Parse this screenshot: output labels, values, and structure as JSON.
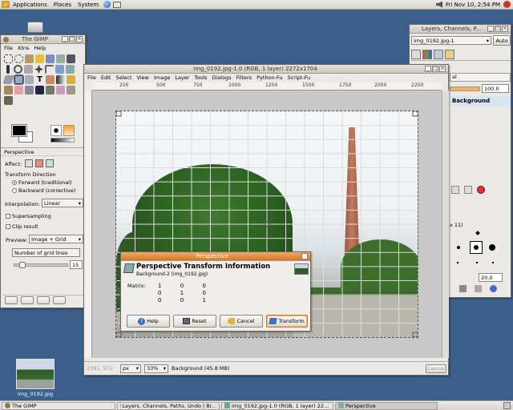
{
  "topbar": {
    "menus": [
      "Applications",
      "Places",
      "System"
    ],
    "datetime": "Fri Nov 10,  2:54 PM"
  },
  "desktop": {
    "file_label": "img_0192.jpg"
  },
  "toolbox": {
    "title": "The GIMP",
    "menus": [
      "File",
      "Xtns",
      "Help"
    ],
    "options_title": "Perspective",
    "affect_label": "Affect:",
    "direction_label": "Transform Direction",
    "forward_label": "Forward (traditional)",
    "backward_label": "Backward (corrective)",
    "interpolation_label": "Interpolation:",
    "interpolation_value": "Linear",
    "supersampling_label": "Supersampling",
    "clip_label": "Clip result",
    "preview_label": "Preview:",
    "preview_value": "Image + Grid",
    "grid_lines_label": "Number of grid lines",
    "grid_lines_value": "15"
  },
  "image_window": {
    "title": "img_0192.jpg-1.0 (RGB, 1 layer) 2272x1704",
    "menus": [
      "File",
      "Edit",
      "Select",
      "View",
      "Image",
      "Layer",
      "Tools",
      "Dialogs",
      "Filters",
      "Python-Fu",
      "Script-Fu"
    ],
    "ruler_ticks": [
      "250",
      "500",
      "750",
      "1000",
      "1250",
      "1500",
      "1750",
      "2000",
      "2250"
    ],
    "coords": "2391, 972",
    "unit": "px",
    "zoom": "33%",
    "status": "Background (45.8 MB)",
    "cancel_label": "Cancel"
  },
  "layers": {
    "title": "Layers, Channels, P...",
    "image_select": "img_0192.jpg-1",
    "auto_label": "Auto",
    "mode_value": "al",
    "opacity_value": "100.0",
    "layer_name": "Background",
    "brush_title": "x 11)",
    "spacing_value": "20.0"
  },
  "dialog": {
    "title": "Perspective",
    "heading": "Perspective Transform Information",
    "subheading": "Background-2 (img_0192.jpg)",
    "matrix_label": "Matrix:",
    "matrix": [
      [
        "1",
        "0",
        "0"
      ],
      [
        "0",
        "1",
        "0"
      ],
      [
        "0",
        "0",
        "1"
      ]
    ],
    "buttons": {
      "help": "Help",
      "reset": "Reset",
      "cancel": "Cancel",
      "transform": "Transform"
    }
  },
  "taskbar": [
    {
      "label": "The GIMP",
      "active": false
    },
    {
      "label": "Layers, Channels, Paths, Undo | Br...",
      "active": false
    },
    {
      "label": "img_0192.jpg-1.0 (RGB, 1 layer) 22...",
      "active": false
    },
    {
      "label": "Perspective",
      "active": true
    }
  ],
  "colors": {
    "desktop": "#3b5f8a",
    "accent": "#4a73b1",
    "dialog_title": "#e08a3a"
  }
}
